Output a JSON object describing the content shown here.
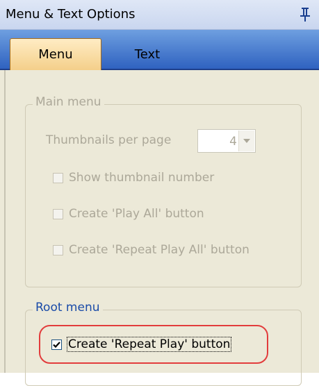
{
  "panel": {
    "title": "Menu & Text Options",
    "pin_icon": "pin-icon"
  },
  "tabs": [
    {
      "label": "Menu",
      "active": true
    },
    {
      "label": "Text",
      "active": false
    }
  ],
  "main_menu": {
    "legend": "Main menu",
    "thumbnails_label": "Thumbnails per page",
    "thumbnails_value": "4",
    "options": [
      {
        "label": "Show thumbnail number",
        "checked": false
      },
      {
        "label": "Create 'Play All' button",
        "checked": false
      },
      {
        "label": "Create 'Repeat Play All' button",
        "checked": false
      }
    ]
  },
  "root_menu": {
    "legend": "Root menu",
    "options": [
      {
        "label": "Create 'Repeat Play' button",
        "checked": true
      }
    ]
  },
  "colors": {
    "highlight": "#e23c3c",
    "tab_active": "#f4cf8a",
    "tabstrip": "#2f62c0"
  }
}
